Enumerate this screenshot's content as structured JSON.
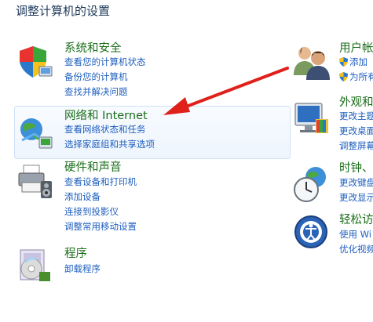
{
  "page": {
    "title": "调整计算机的设置"
  },
  "categories": {
    "system_security": {
      "title": "系统和安全",
      "icon": "shield-flag-icon",
      "links": [
        "查看您的计算机状态",
        "备份您的计算机",
        "查找并解决问题"
      ]
    },
    "network": {
      "title": "网络和 Internet",
      "icon": "network-globe-icon",
      "links": [
        "查看网络状态和任务",
        "选择家庭组和共享选项"
      ]
    },
    "hardware_sound": {
      "title": "硬件和声音",
      "icon": "printer-speaker-icon",
      "links": [
        "查看设备和打印机",
        "添加设备",
        "连接到投影仪",
        "调整常用移动设置"
      ]
    },
    "programs": {
      "title": "程序",
      "icon": "programs-disc-icon",
      "links": [
        "卸载程序"
      ]
    },
    "user_accounts": {
      "title": "用户帐",
      "icon": "users-icon",
      "links": [
        "添加",
        "为所有"
      ]
    },
    "appearance": {
      "title": "外观和",
      "icon": "appearance-monitor-icon",
      "links": [
        "更改主题",
        "更改桌面",
        "调整屏幕"
      ]
    },
    "clock": {
      "title": "时钟、",
      "icon": "clock-globe-icon",
      "links": [
        "更改键盘",
        "更改显示"
      ]
    },
    "ease_of_access": {
      "title": "轻松访",
      "icon": "ease-of-access-icon",
      "links": [
        "使用 Wi",
        "优化视频"
      ]
    }
  },
  "annotation": {
    "color": "#e0201b",
    "icon": "red-arrow-icon"
  }
}
